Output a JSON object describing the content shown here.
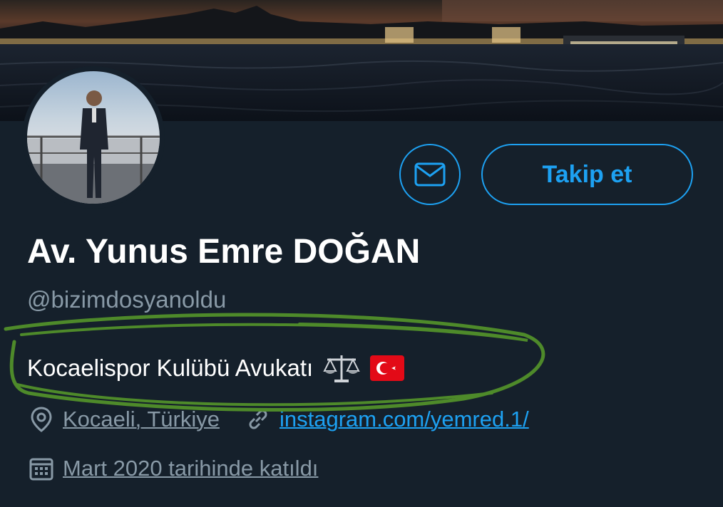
{
  "profile": {
    "name": "Av. Yunus Emre DOĞAN",
    "handle": "@bizimdosyanoldu",
    "bio": "Kocaelispor Kulübü Avukatı",
    "bio_emojis": [
      "balance-scale-icon",
      "turkey-flag-icon"
    ],
    "location": "Kocaeli, Türkiye",
    "website": "instagram.com/yemred.1/",
    "joined": "Mart 2020 tarihinde katıldı"
  },
  "actions": {
    "message_icon": "envelope-icon",
    "follow_label": "Takip et"
  },
  "colors": {
    "background": "#15202b",
    "accent": "#1da1f2",
    "secondary_text": "#8899a6",
    "annotation": "#4e8a2a"
  }
}
